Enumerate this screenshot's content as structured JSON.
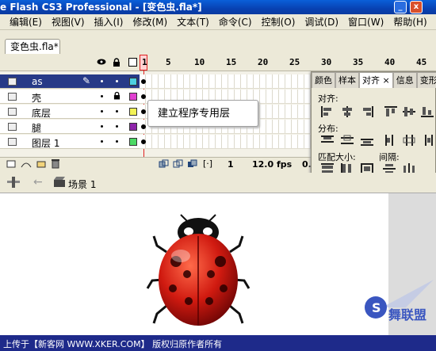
{
  "window": {
    "title": "e Flash CS3 Professional - [变色虫.fla*]",
    "minimize": "_",
    "close": "x"
  },
  "menu": [
    "编辑(E)",
    "视图(V)",
    "插入(I)",
    "修改(M)",
    "文本(T)",
    "命令(C)",
    "控制(O)",
    "调试(D)",
    "窗口(W)",
    "帮助(H)"
  ],
  "document_tab": "变色虫.fla*",
  "timeline": {
    "frame_numbers": [
      "1",
      "5",
      "10",
      "15",
      "20",
      "25",
      "30",
      "35",
      "40",
      "45"
    ],
    "layers": [
      {
        "name": "as",
        "color": "#4dd0e1",
        "selected": true,
        "locked": false
      },
      {
        "name": "壳",
        "color": "#e040d0",
        "selected": false,
        "locked": true
      },
      {
        "name": "底层",
        "color": "#f2f255",
        "selected": false,
        "locked": false
      },
      {
        "name": "腿",
        "color": "#8e24aa",
        "selected": false,
        "locked": false
      },
      {
        "name": "图层 1",
        "color": "#4cd964",
        "selected": false,
        "locked": false
      }
    ],
    "footer": {
      "current_frame": "1",
      "fps": "12.0 fps",
      "time": "0."
    }
  },
  "tooltip": "建立程序专用层",
  "align_panel": {
    "tabs": [
      "颜色",
      "样本",
      "对齐",
      "信息",
      "变形"
    ],
    "active_tab": "对齐",
    "close_glyph": "×",
    "section_align": "对齐:",
    "section_distribute": "分布:",
    "section_match_size": "匹配大小:",
    "section_spacing": "间隔:"
  },
  "edit_bar": {
    "scene_label": "场景 1"
  },
  "watermark": {
    "text": "上传于【新客网 WWW.XKER.COM】 版权归原作者所有",
    "logo_text": "舞联盟",
    "logo_letter": "S"
  },
  "colors": {
    "title_bar": "#0a4fc8",
    "selected_layer": "#273a87",
    "playhead": "#e02020",
    "watermark_band": "#1e2a8a"
  }
}
